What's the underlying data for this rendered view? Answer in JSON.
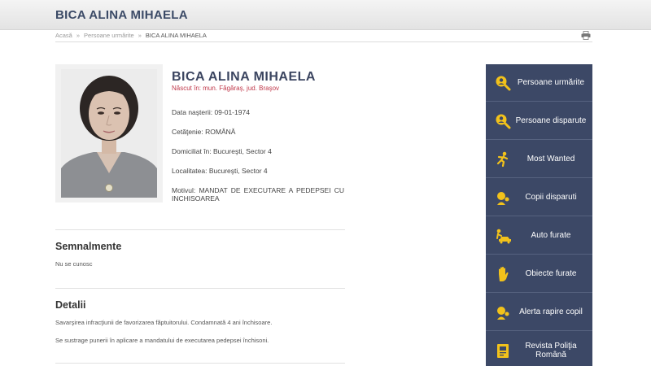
{
  "header": {
    "title": "BICA ALINA MIHAELA"
  },
  "breadcrumb": {
    "items": [
      "Acasă",
      "Persoane urmărite",
      "BICA ALINA MIHAELA"
    ],
    "separator": "»"
  },
  "profile": {
    "name": "BICA ALINA MIHAELA",
    "born": "Născut în: mun. Făgăraş, jud. Braşov",
    "fields": [
      "Data naşterii: 09-01-1974",
      "Cetăţenie: ROMÂNĂ",
      "Domiciliat în: Bucureşti, Sector 4",
      "Localitatea: Bucureşti, Sector 4",
      "Motivul: MANDAT DE EXECUTARE A PEDEPSEI CU INCHISOAREA"
    ]
  },
  "semnalmente": {
    "title": "Semnalmente",
    "text": "Nu se cunosc"
  },
  "detalii": {
    "title": "Detalii",
    "paragraphs": [
      "Savarşirea infracţiunii de favorizarea făptuitorului. Condamnată 4 ani închisoare.",
      "Se sustrage punerii în aplicare a mandatului de executarea pedepsei închisoni."
    ]
  },
  "sidebar": {
    "items": [
      {
        "label": "Persoane urmărite",
        "icon": "magnifier-person-icon"
      },
      {
        "label": "Persoane disparute",
        "icon": "magnifier-person-icon"
      },
      {
        "label": "Most Wanted",
        "icon": "running-person-icon"
      },
      {
        "label": "Copii disparuti",
        "icon": "child-icon"
      },
      {
        "label": "Auto furate",
        "icon": "car-thief-icon"
      },
      {
        "label": "Obiecte furate",
        "icon": "hand-icon"
      },
      {
        "label": "Alerta rapire copil",
        "icon": "child-alert-icon"
      },
      {
        "label": "Revista Poliţia Română",
        "icon": "magazine-icon"
      }
    ]
  },
  "colors": {
    "sidebar_bg": "#3c4866",
    "icon_yellow": "#f2c21b",
    "born_red": "#c0394b"
  }
}
